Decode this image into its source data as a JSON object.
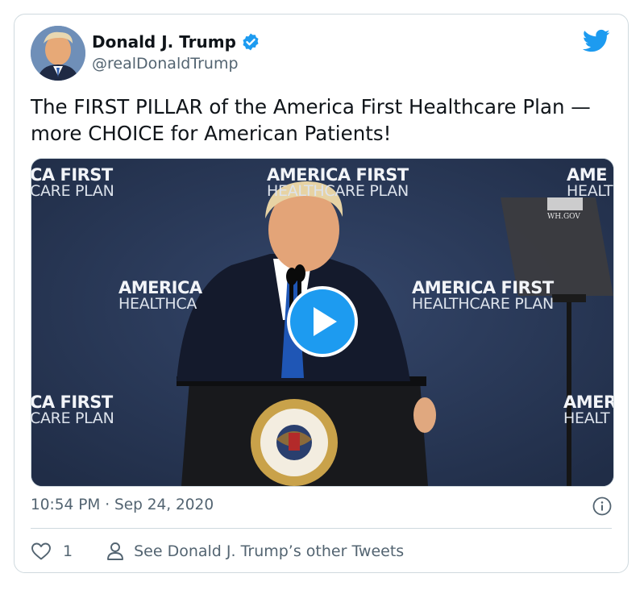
{
  "author": {
    "name": "Donald J. Trump",
    "handle": "@realDonaldTrump",
    "verified": true
  },
  "tweet": {
    "text": "The FIRST PILLAR of the America First Healthcare Plan —more CHOICE for American Patients!",
    "timestamp": "10:54 PM · Sep 24, 2020"
  },
  "media": {
    "type": "video",
    "backdrop": [
      {
        "title": "CA FIRST",
        "sub": "CARE PLAN"
      },
      {
        "title": "AMERICA FIRST",
        "sub": "HEALTHCARE PLAN"
      },
      {
        "title": "AME",
        "sub": "HEALT"
      },
      {
        "title": "AMERICA",
        "sub": "HEALTHCA"
      },
      {
        "title": "AMERICA FIRST",
        "sub": "HEALTHCARE PLAN"
      },
      {
        "title": "CA FIRST",
        "sub": "CARE PLAN"
      },
      {
        "title": "AMER",
        "sub": "HEALT"
      }
    ],
    "prompter_label": "WH.GOV",
    "seal_top": "SEAL OF THE PRESIDENT OF THE UNITED STATES"
  },
  "actions": {
    "like_count": "1",
    "other_tweets_label": "See Donald J. Trump’s other Tweets"
  },
  "colors": {
    "accent": "#1d9bf0",
    "muted": "#536471",
    "border": "#cfd9de"
  },
  "icons": [
    "twitter-bird-icon",
    "verified-badge-icon",
    "play-icon",
    "info-icon",
    "heart-icon",
    "person-icon"
  ]
}
